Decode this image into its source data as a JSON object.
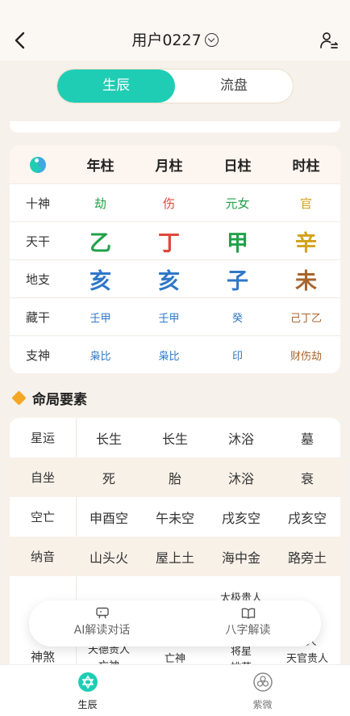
{
  "header": {
    "title": "用户0227"
  },
  "segment": {
    "active": "生辰",
    "inactive": "流盘"
  },
  "pillars": {
    "headers": [
      "年柱",
      "月柱",
      "日柱",
      "时柱"
    ],
    "rows": [
      {
        "label": "十神",
        "cells": [
          "劫",
          "伤",
          "元女",
          "官"
        ]
      },
      {
        "label": "天干",
        "cells": [
          "乙",
          "丁",
          "甲",
          "辛"
        ]
      },
      {
        "label": "地支",
        "cells": [
          "亥",
          "亥",
          "子",
          "未"
        ]
      },
      {
        "label": "藏干",
        "cells": [
          "壬甲",
          "壬甲",
          "癸",
          "己丁乙"
        ]
      },
      {
        "label": "支神",
        "cells": [
          "枭比",
          "枭比",
          "印",
          "财伤劫"
        ]
      }
    ]
  },
  "section": {
    "title": "命局要素"
  },
  "elements": {
    "rows": [
      {
        "label": "星运",
        "cells": [
          "长生",
          "长生",
          "沐浴",
          "墓"
        ]
      },
      {
        "label": "自坐",
        "cells": [
          "死",
          "胎",
          "沐浴",
          "衰"
        ]
      },
      {
        "label": "空亡",
        "cells": [
          "申酉空",
          "午未空",
          "戌亥空",
          "戌亥空"
        ]
      },
      {
        "label": "纳音",
        "cells": [
          "山头火",
          "屋上土",
          "海中金",
          "路旁土"
        ]
      }
    ],
    "shensha_label": "神煞",
    "shensha_visible": [
      "太极贵人",
      "天德贵人",
      "亡神",
      "亡神",
      "将星",
      "桃花",
      "人",
      "天官贵人"
    ]
  },
  "float_actions": [
    {
      "label": "AI解读对话"
    },
    {
      "label": "八字解读"
    }
  ],
  "tabs": [
    {
      "label": "生辰"
    },
    {
      "label": "紫微"
    }
  ],
  "colors": {
    "accent": "#1fcdb4",
    "green": "#23a04a",
    "red": "#e0463a",
    "gold": "#d2a21a",
    "blue": "#2f77c8",
    "brown": "#a8642d"
  }
}
